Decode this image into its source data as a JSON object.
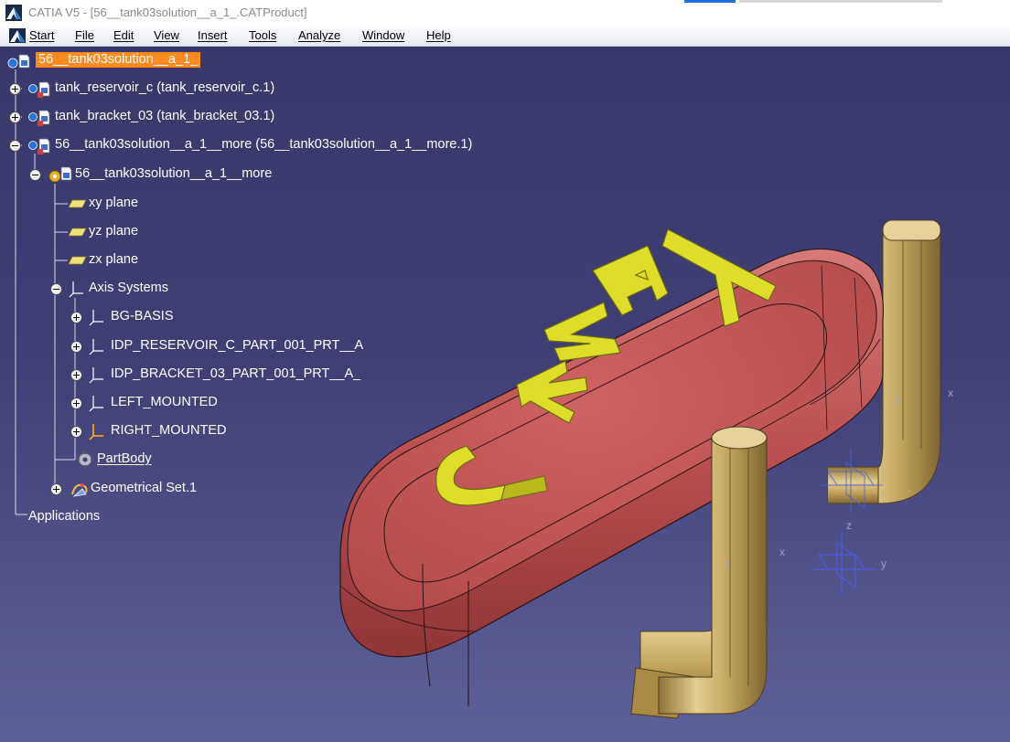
{
  "window": {
    "title": "CATIA V5 - [56__tank03solution__a_1_.CATProduct]"
  },
  "menu": {
    "items": [
      "Start",
      "File",
      "Edit",
      "View",
      "Insert",
      "Tools",
      "Analyze",
      "Window",
      "Help"
    ]
  },
  "tree": {
    "root": "56__tank03solution__a_1_",
    "nodes": [
      "tank_reservoir_c (tank_reservoir_c.1)",
      "tank_bracket_03 (tank_bracket_03.1)",
      "56__tank03solution__a_1__more (56__tank03solution__a_1__more.1)",
      "56__tank03solution__a_1__more",
      "xy plane",
      "yz plane",
      "zx plane",
      "Axis Systems",
      "BG-BASIS",
      "IDP_RESERVOIR_C_PART_001_PRT__A",
      "IDP_BRACKET_03_PART_001_PRT__A_",
      "LEFT_MOUNTED",
      "RIGHT_MOUNTED",
      "PartBody",
      "Geometrical Set.1",
      "Applications"
    ]
  },
  "model": {
    "embossed_text": "TANK C",
    "axis_labels": [
      "x",
      "y",
      "z"
    ]
  },
  "colors": {
    "viewport_top": "#39386a",
    "viewport_bottom": "#5d5f98",
    "tank_body": "#c15959",
    "bracket": "#c2a45c",
    "lettering": "#dede2a",
    "selection": "#ff8a1e"
  }
}
